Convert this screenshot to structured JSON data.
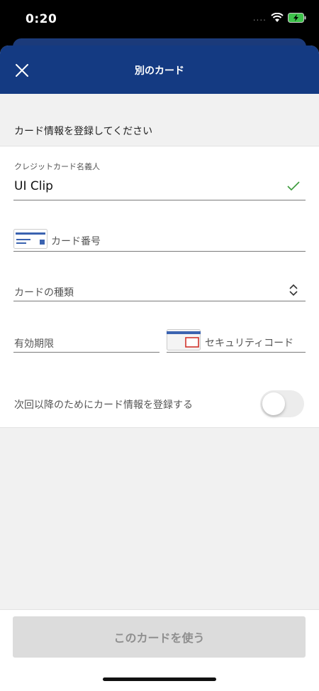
{
  "status_bar": {
    "time": "0:20",
    "signal": "....",
    "icons": [
      "wifi-icon",
      "battery-charging-icon"
    ]
  },
  "nav": {
    "title": "別のカード",
    "close_icon": "close-icon"
  },
  "section": {
    "header": "カード情報を登録してください"
  },
  "form": {
    "cardholder": {
      "label": "クレジットカード名義人",
      "value": "UI Clip",
      "valid_icon": "checkmark-icon"
    },
    "card_number": {
      "placeholder": "カード番号",
      "icon": "card-front-icon"
    },
    "card_type": {
      "placeholder": "カードの種類",
      "icon": "up-down-chevron-icon"
    },
    "expiry": {
      "placeholder": "有効期限"
    },
    "security_code": {
      "placeholder": "セキュリティコード",
      "icon": "card-back-icon"
    },
    "save_card": {
      "label": "次回以降のためにカード情報を登録する",
      "enabled": false
    }
  },
  "footer": {
    "use_button": "このカードを使う"
  },
  "colors": {
    "nav": "#143a82",
    "check": "#3a9a3a",
    "disabled_button": "#dcdcdc",
    "cvc_red": "#d0342c",
    "card_blue": "#3b63b0"
  }
}
